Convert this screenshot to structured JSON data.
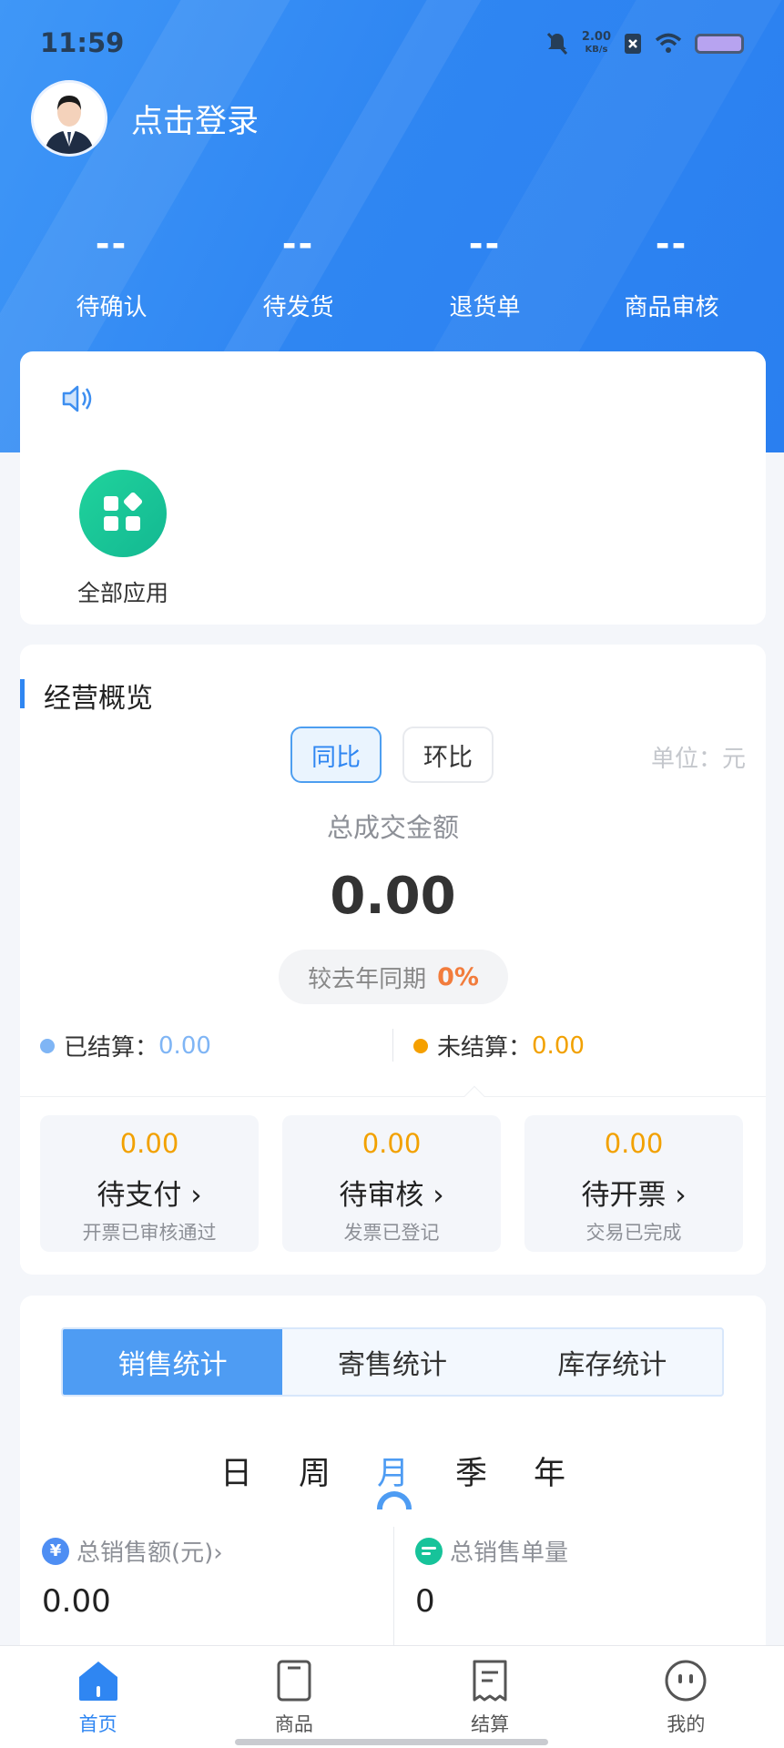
{
  "status_bar": {
    "time": "11:59",
    "net_speed_value": "2.00",
    "net_speed_unit": "KB/s"
  },
  "header": {
    "login_text": "点击登录",
    "stats": [
      {
        "value": "--",
        "label": "待确认"
      },
      {
        "value": "--",
        "label": "待发货"
      },
      {
        "value": "--",
        "label": "退货单"
      },
      {
        "value": "--",
        "label": "商品审核"
      }
    ]
  },
  "apps": {
    "all_apps_label": "全部应用"
  },
  "overview": {
    "title": "经营概览",
    "yoy_label": "同比",
    "mom_label": "环比",
    "unit": "单位：元",
    "metric_label": "总成交金额",
    "metric_value": "0.00",
    "compare_text": "较去年同期",
    "compare_pct": "0%",
    "settled_label": "已结算：",
    "settled_value": "0.00",
    "unsettled_label": "未结算：",
    "unsettled_value": "0.00",
    "pending": [
      {
        "amount": "0.00",
        "label": "待支付 ›",
        "sub": "开票已审核通过"
      },
      {
        "amount": "0.00",
        "label": "待审核 ›",
        "sub": "发票已登记"
      },
      {
        "amount": "0.00",
        "label": "待开票 ›",
        "sub": "交易已完成"
      }
    ]
  },
  "sales": {
    "tabs": [
      "销售统计",
      "寄售统计",
      "库存统计"
    ],
    "periods": [
      "日",
      "周",
      "月",
      "季",
      "年"
    ],
    "total_amount_label": "总销售额(元)›",
    "total_amount_value": "0.00",
    "total_orders_label": "总销售单量",
    "total_orders_value": "0"
  },
  "nav": {
    "items": [
      "首页",
      "商品",
      "结算",
      "我的"
    ]
  },
  "colors": {
    "primary": "#2f86f2",
    "accent_orange": "#f2a100",
    "green": "#13b892"
  }
}
